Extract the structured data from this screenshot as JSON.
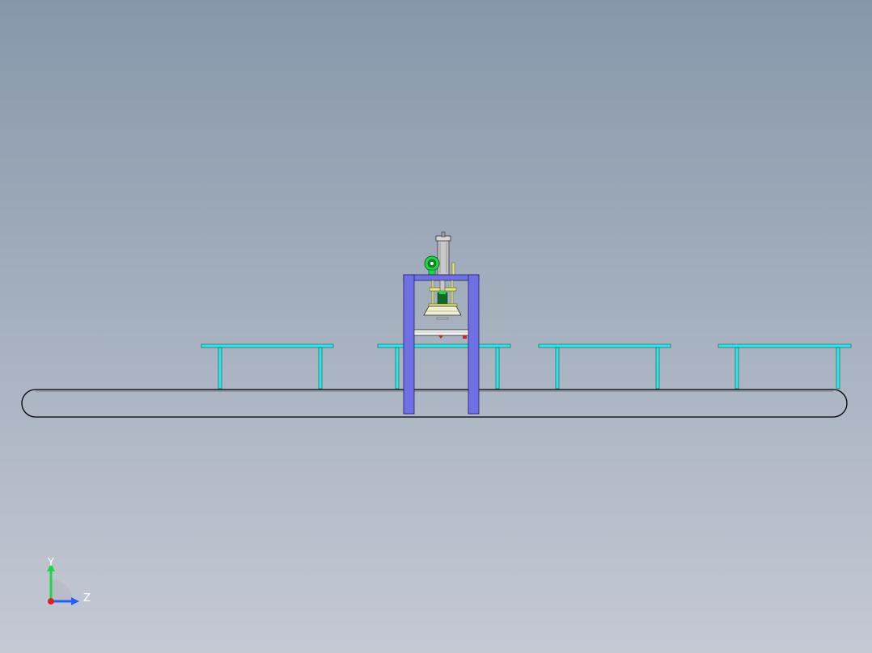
{
  "viewport": {
    "background_top": "#8797aa",
    "background_bottom": "#c4c9d4"
  },
  "colors": {
    "conveyor_outline": "#000000",
    "fixture_tables": "#2ee6e6",
    "press_frame": "#7070e6",
    "press_frame_edge": "#20205a",
    "cylinder": "#c8c8c8",
    "valve": "#1fd64a",
    "guide_rods": "#e6e67a",
    "die": "#f0f0d0",
    "accent_red": "#d02020"
  },
  "triad": {
    "y_label": "Y",
    "z_label": "Z",
    "y_color": "#1fd64a",
    "z_color": "#2060ff",
    "x_color": "#e02020"
  }
}
